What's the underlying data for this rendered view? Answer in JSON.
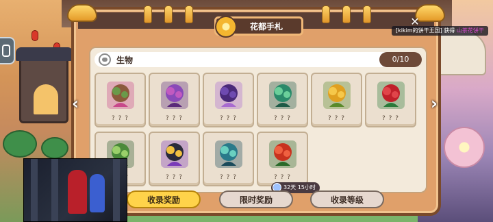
{
  "panel": {
    "title": "花都手札",
    "category": "生物",
    "progress": "0/10"
  },
  "cards": [
    {
      "label": "? ? ?",
      "art": "mushroom-creature",
      "colors": [
        "#8b5a3c",
        "#6a9a4a",
        "#c8488a"
      ]
    },
    {
      "label": "? ? ?",
      "art": "purple-snake",
      "colors": [
        "#8a4ab8",
        "#c25ac0",
        "#5a2a7a"
      ]
    },
    {
      "label": "? ? ?",
      "art": "purple-bat",
      "colors": [
        "#4a2a7a",
        "#6e4ab0",
        "#a86ad0"
      ]
    },
    {
      "label": "? ? ?",
      "art": "green-leafy-beast",
      "colors": [
        "#2a8a6a",
        "#6acf9a",
        "#1d5a46"
      ]
    },
    {
      "label": "? ? ?",
      "art": "yellow-rose",
      "colors": [
        "#e0a020",
        "#f6c84a",
        "#5a8a2a"
      ]
    },
    {
      "label": "? ? ?",
      "art": "red-rose",
      "colors": [
        "#c0202a",
        "#e0454a",
        "#2a7a3a"
      ]
    },
    {
      "label": "? ? ?",
      "art": "jungle-scene",
      "colors": [
        "#4a8a3a",
        "#9ad06a",
        "#2a5a2a"
      ]
    },
    {
      "label": "? ? ?",
      "art": "witch-cookie",
      "colors": [
        "#2a2a3a",
        "#f0c040",
        "#7a3ab8"
      ]
    },
    {
      "label": "? ? ?",
      "art": "teal-leaf-creature",
      "colors": [
        "#2a7a8a",
        "#6ad0c0",
        "#1a4a5a"
      ]
    },
    {
      "label": "? ? ?",
      "art": "red-camellia",
      "colors": [
        "#c8321e",
        "#ef6040",
        "#2a6a2a"
      ]
    }
  ],
  "timer": "32天 15小时",
  "buttons": {
    "collect_reward": "收录奖励",
    "limited_reward": "限时奖励",
    "collect_level": "收录等级"
  },
  "notice": {
    "prefix": "[kikim的饼干王国] 获得 ",
    "highlight": "山茶花饼干"
  },
  "icons": {
    "close": "close-icon",
    "prev": "chevron-left-icon",
    "next": "chevron-right-icon",
    "category": "creature-icon",
    "emblem": "sun-emblem-icon",
    "timer": "clock-icon"
  },
  "accent_colors": {
    "primary_button": "#ffd34a",
    "secondary_button": "#e6d8cf",
    "panel_frame": "#7a4a2a",
    "progress_pill": "#6e4a38"
  }
}
